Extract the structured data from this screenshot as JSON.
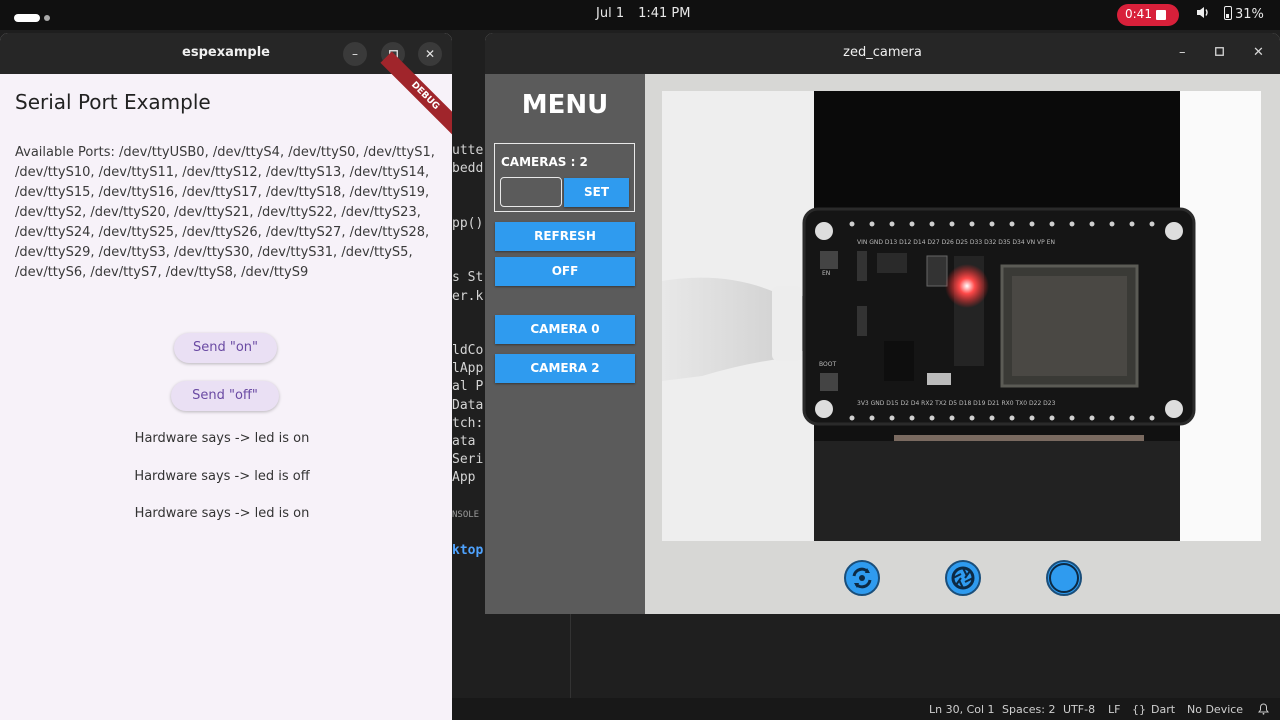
{
  "topbar": {
    "date": "Jul 1",
    "time": "1:41 PM",
    "recording": "0:41",
    "battery": "31%"
  },
  "editor": {
    "code_lines": [
      "utte",
      "bedd",
      "",
      "",
      "pp()",
      "",
      "",
      "s St",
      "er.k",
      "",
      "",
      "ldCo",
      "lApp",
      "al P",
      "Data",
      "tch:",
      "ata",
      "Seri",
      "App",
      "",
      "NSOLE",
      "",
      "ktop"
    ],
    "status": {
      "position": "Ln 30, Col 1",
      "spaces": "Spaces: 2",
      "encoding": "UTF-8",
      "eol": "LF",
      "language_icon": "{}",
      "language": "Dart",
      "device": "No Device"
    }
  },
  "esp": {
    "title": "espexample",
    "heading": "Serial Port Example",
    "ports": "Available Ports: /dev/ttyUSB0, /dev/ttyS4, /dev/ttyS0, /dev/ttyS1, /dev/ttyS10, /dev/ttyS11, /dev/ttyS12, /dev/ttyS13, /dev/ttyS14, /dev/ttyS15, /dev/ttyS16, /dev/ttyS17, /dev/ttyS18, /dev/ttyS19, /dev/ttyS2, /dev/ttyS20, /dev/ttyS21, /dev/ttyS22, /dev/ttyS23, /dev/ttyS24, /dev/ttyS25, /dev/ttyS26, /dev/ttyS27, /dev/ttyS28, /dev/ttyS29, /dev/ttyS3, /dev/ttyS30, /dev/ttyS31, /dev/ttyS5, /dev/ttyS6, /dev/ttyS7, /dev/ttyS8, /dev/ttyS9",
    "send_on": "Send \"on\"",
    "send_off": "Send \"off\"",
    "log": [
      "Hardware says -> led is on",
      "Hardware says -> led is off",
      "Hardware says -> led is on"
    ],
    "debug_banner": "DEBUG"
  },
  "zed": {
    "title": "zed_camera",
    "menu_title": "MENU",
    "cameras_label": "CAMERAS : 2",
    "camera_input": "",
    "set": "SET",
    "refresh": "REFRESH",
    "off": "OFF",
    "camera0": "CAMERA 0",
    "camera2": "CAMERA 2",
    "board_silkscreen_bottom": "3V3 GND D15 D2 D4 RX2 TX2 D5 D18 D19 D21 RX0 TX0 D22 D23",
    "board_silkscreen_top": "VIN GND D13 D12 D14 D27 D26 D25 D33 D32 D35 D34 VN VP EN",
    "board_labels": [
      "EN",
      "BOOT"
    ]
  },
  "colors": {
    "accent_blue": "#2f9bef",
    "record_red": "#d8203a",
    "debug_red": "#a0252b",
    "pill_text": "#6a4aa3"
  },
  "icons": [
    "switch-camera-icon",
    "shutter-icon",
    "record-icon",
    "minimize-icon",
    "maximize-icon",
    "close-icon",
    "volume-icon",
    "battery-icon"
  ]
}
